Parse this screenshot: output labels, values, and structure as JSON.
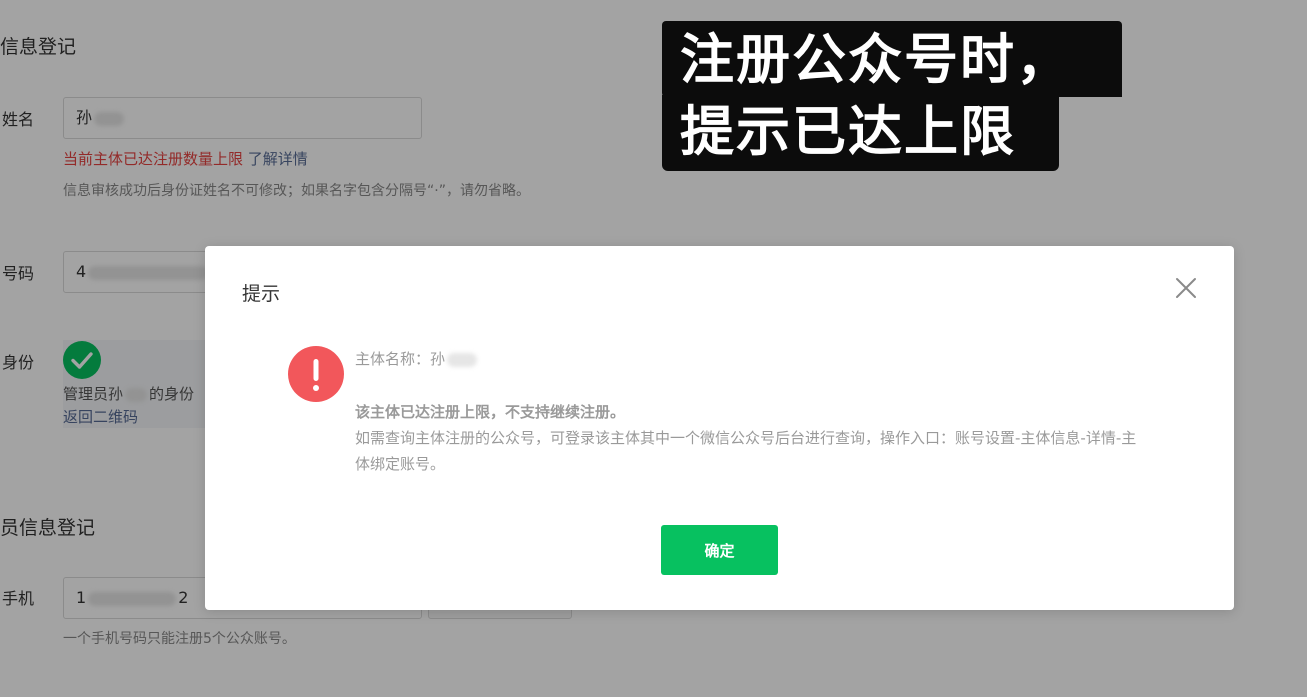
{
  "form": {
    "section_info_title": "信息登记",
    "name_label": "姓名",
    "name_value_visible": "孙",
    "name_error": "当前主体已达注册数量上限",
    "learn_more_link": "了解详情",
    "name_hint": "信息审核成功后身份证姓名不可修改；如果名字包含分隔号“·”，请勿省略。",
    "id_label": "号码",
    "id_value_visible": "4",
    "identity_label": "身份",
    "admin_text": "管理员孙",
    "admin_text_suffix": "的身份",
    "back_qr_link": "返回二维码",
    "section_admin_title": "员信息登记",
    "phone_label": "手机",
    "phone_value_start": "1",
    "phone_value_end": "2",
    "phone_hint": "一个手机号码只能注册5个公众账号。"
  },
  "caption": {
    "line1": "注册公众号时，",
    "line2": "提示已达上限"
  },
  "dialog": {
    "title": "提示",
    "subject_label": "主体名称：孙",
    "message_main": "该主体已达注册上限，不支持继续注册。",
    "message_detail": "如需查询主体注册的公众号，可登录该主体其中一个微信公众号后台进行查询，操作入口：账号设置-主体信息-详情-主体绑定账号。",
    "confirm_label": "确定"
  },
  "colors": {
    "error_red": "#e64340",
    "link_blue": "#576b95",
    "wechat_green": "#07c160",
    "warning_red": "#f2575b"
  }
}
